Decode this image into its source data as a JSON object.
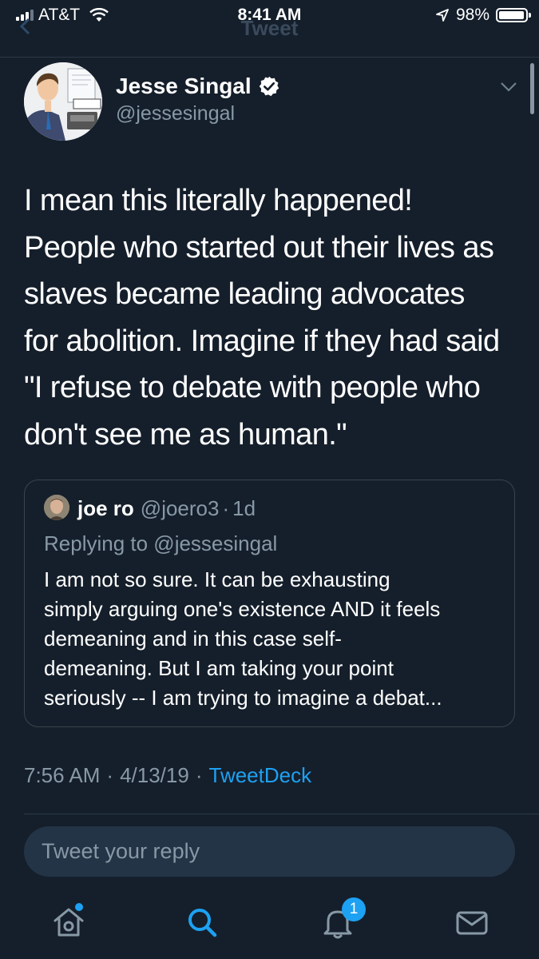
{
  "status_bar": {
    "carrier": "AT&T",
    "time": "8:41 AM",
    "battery": "98%",
    "battery_level": 0.98
  },
  "nav": {
    "title": "Tweet"
  },
  "tweet": {
    "author_name": "Jesse Singal",
    "author_handle": "@jessesingal",
    "verified": true,
    "text": "I mean this literally happened!\nPeople who started out their lives as\nslaves became leading advocates\nfor abolition. Imagine if they had said\n\"I refuse to debate with people who\ndon't see me as human.\"",
    "time": "7:56 AM",
    "date": "4/13/19",
    "separator": "·",
    "source": "TweetDeck"
  },
  "quoted_tweet": {
    "author_name": "joe ro",
    "author_handle": "@joero3",
    "separator": "·",
    "age": "1d",
    "replying_to": "Replying to @jessesingal",
    "text": "I am not so sure. It can be exhausting\nsimply arguing one's existence AND it feels\ndemeaning and in this case self-\ndemeaning. But I am taking your point\nseriously -- I am trying to imagine a debat..."
  },
  "reply": {
    "placeholder": "Tweet your reply"
  },
  "tab_bar": {
    "items": [
      {
        "icon": "home-icon",
        "has_dot": true
      },
      {
        "icon": "search-icon",
        "active": true
      },
      {
        "icon": "notifications-bell-icon",
        "badge": "1"
      },
      {
        "icon": "messages-envelope-icon"
      }
    ]
  },
  "colors": {
    "background": "#151f2b",
    "accent": "#1da1f2",
    "secondary_text": "#8899a6",
    "border": "#38444d"
  }
}
